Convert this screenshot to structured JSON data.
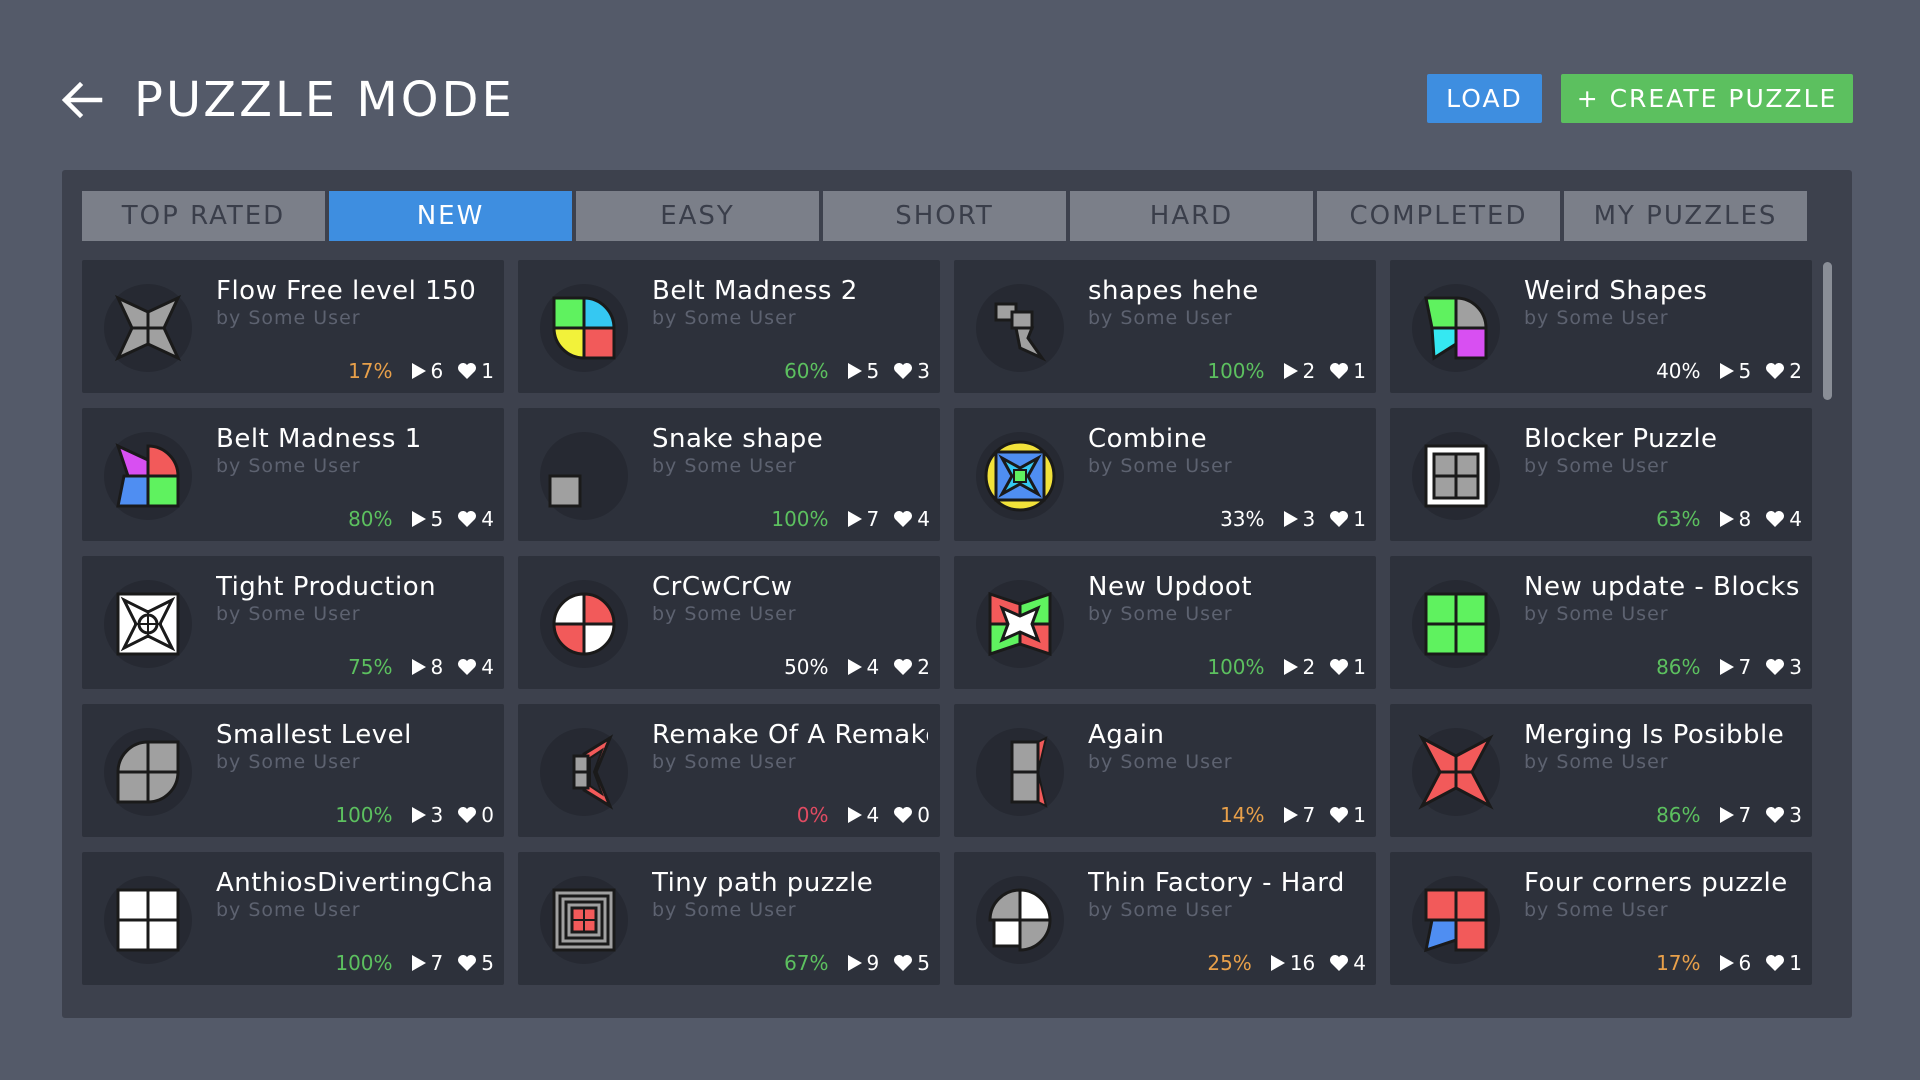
{
  "header": {
    "title": "PUZZLE MODE",
    "load_label": "LOAD",
    "create_label": "+ CREATE PUZZLE"
  },
  "colors": {
    "accent_blue": "#3e8ee0",
    "accent_green": "#5cc05f",
    "pct_green": "#5cc05f",
    "pct_orange": "#e8a04a",
    "pct_red": "#e14b62",
    "pct_white": "#ffffff"
  },
  "tabs": [
    {
      "label": "TOP RATED",
      "active": false
    },
    {
      "label": "NEW",
      "active": true
    },
    {
      "label": "EASY",
      "active": false
    },
    {
      "label": "SHORT",
      "active": false
    },
    {
      "label": "HARD",
      "active": false
    },
    {
      "label": "COMPLETED",
      "active": false
    },
    {
      "label": "MY PUZZLES",
      "active": false
    }
  ],
  "puzzles": [
    {
      "title": "Flow Free level 150",
      "author": "by Some User",
      "pct": "17%",
      "pct_color": "#e8a04a",
      "plays": "6",
      "likes": "1",
      "icon": "star-gray-icon"
    },
    {
      "title": "Belt Madness 2",
      "author": "by Some User",
      "pct": "60%",
      "pct_color": "#5cc05f",
      "plays": "5",
      "likes": "3",
      "icon": "four-color-circle-icon"
    },
    {
      "title": "shapes hehe",
      "author": "by Some User",
      "pct": "100%",
      "pct_color": "#5cc05f",
      "plays": "2",
      "likes": "1",
      "icon": "stacked-shapes-icon"
    },
    {
      "title": "Weird Shapes",
      "author": "by Some User",
      "pct": "40%",
      "pct_color": "#ffffff",
      "plays": "5",
      "likes": "2",
      "icon": "weird-shapes-icon"
    },
    {
      "title": "Belt Madness 1",
      "author": "by Some User",
      "pct": "80%",
      "pct_color": "#5cc05f",
      "plays": "5",
      "likes": "4",
      "icon": "colorful-windmill-icon"
    },
    {
      "title": "Snake shape",
      "author": "by Some User",
      "pct": "100%",
      "pct_color": "#5cc05f",
      "plays": "7",
      "likes": "4",
      "icon": "small-square-icon"
    },
    {
      "title": "Combine",
      "author": "by Some User",
      "pct": "33%",
      "pct_color": "#ffffff",
      "plays": "3",
      "likes": "1",
      "icon": "combine-circle-icon"
    },
    {
      "title": "Blocker Puzzle",
      "author": "by Some User",
      "pct": "63%",
      "pct_color": "#5cc05f",
      "plays": "8",
      "likes": "4",
      "icon": "framed-squares-icon"
    },
    {
      "title": "Tight Production",
      "author": "by Some User",
      "pct": "75%",
      "pct_color": "#5cc05f",
      "plays": "8",
      "likes": "4",
      "icon": "white-star-box-icon"
    },
    {
      "title": "CrCwCrCw",
      "author": "by Some User",
      "pct": "50%",
      "pct_color": "#ffffff",
      "plays": "4",
      "likes": "2",
      "icon": "red-white-circle-icon"
    },
    {
      "title": "New Updoot",
      "author": "by Some User",
      "pct": "100%",
      "pct_color": "#5cc05f",
      "plays": "2",
      "likes": "1",
      "icon": "updoot-icon"
    },
    {
      "title": "New update - Blocks",
      "author": "by Some User",
      "pct": "86%",
      "pct_color": "#5cc05f",
      "plays": "7",
      "likes": "3",
      "icon": "green-squares-icon"
    },
    {
      "title": "Smallest Level",
      "author": "by Some User",
      "pct": "100%",
      "pct_color": "#5cc05f",
      "plays": "3",
      "likes": "0",
      "icon": "gray-leaf-icon"
    },
    {
      "title": "Remake Of A Remake",
      "author": "by Some User",
      "pct": "0%",
      "pct_color": "#e14b62",
      "plays": "4",
      "likes": "0",
      "icon": "remake-shape-icon"
    },
    {
      "title": "Again",
      "author": "by Some User",
      "pct": "14%",
      "pct_color": "#e8a04a",
      "plays": "7",
      "likes": "1",
      "icon": "again-shape-icon"
    },
    {
      "title": "Merging Is Posibble",
      "author": "by Some User",
      "pct": "86%",
      "pct_color": "#5cc05f",
      "plays": "7",
      "likes": "3",
      "icon": "red-star-icon"
    },
    {
      "title": "AnthiosDivertingChal",
      "author": "by Some User",
      "pct": "100%",
      "pct_color": "#5cc05f",
      "plays": "7",
      "likes": "5",
      "icon": "white-squares-icon"
    },
    {
      "title": "Tiny path puzzle",
      "author": "by Some User",
      "pct": "67%",
      "pct_color": "#5cc05f",
      "plays": "9",
      "likes": "5",
      "icon": "nested-squares-icon"
    },
    {
      "title": "Thin Factory - Hard",
      "author": "by Some User",
      "pct": "25%",
      "pct_color": "#e8a04a",
      "plays": "16",
      "likes": "4",
      "icon": "gray-white-circle-icon"
    },
    {
      "title": "Four corners puzzle",
      "author": "by Some User",
      "pct": "17%",
      "pct_color": "#e8a04a",
      "plays": "6",
      "likes": "1",
      "icon": "red-corners-icon"
    }
  ]
}
